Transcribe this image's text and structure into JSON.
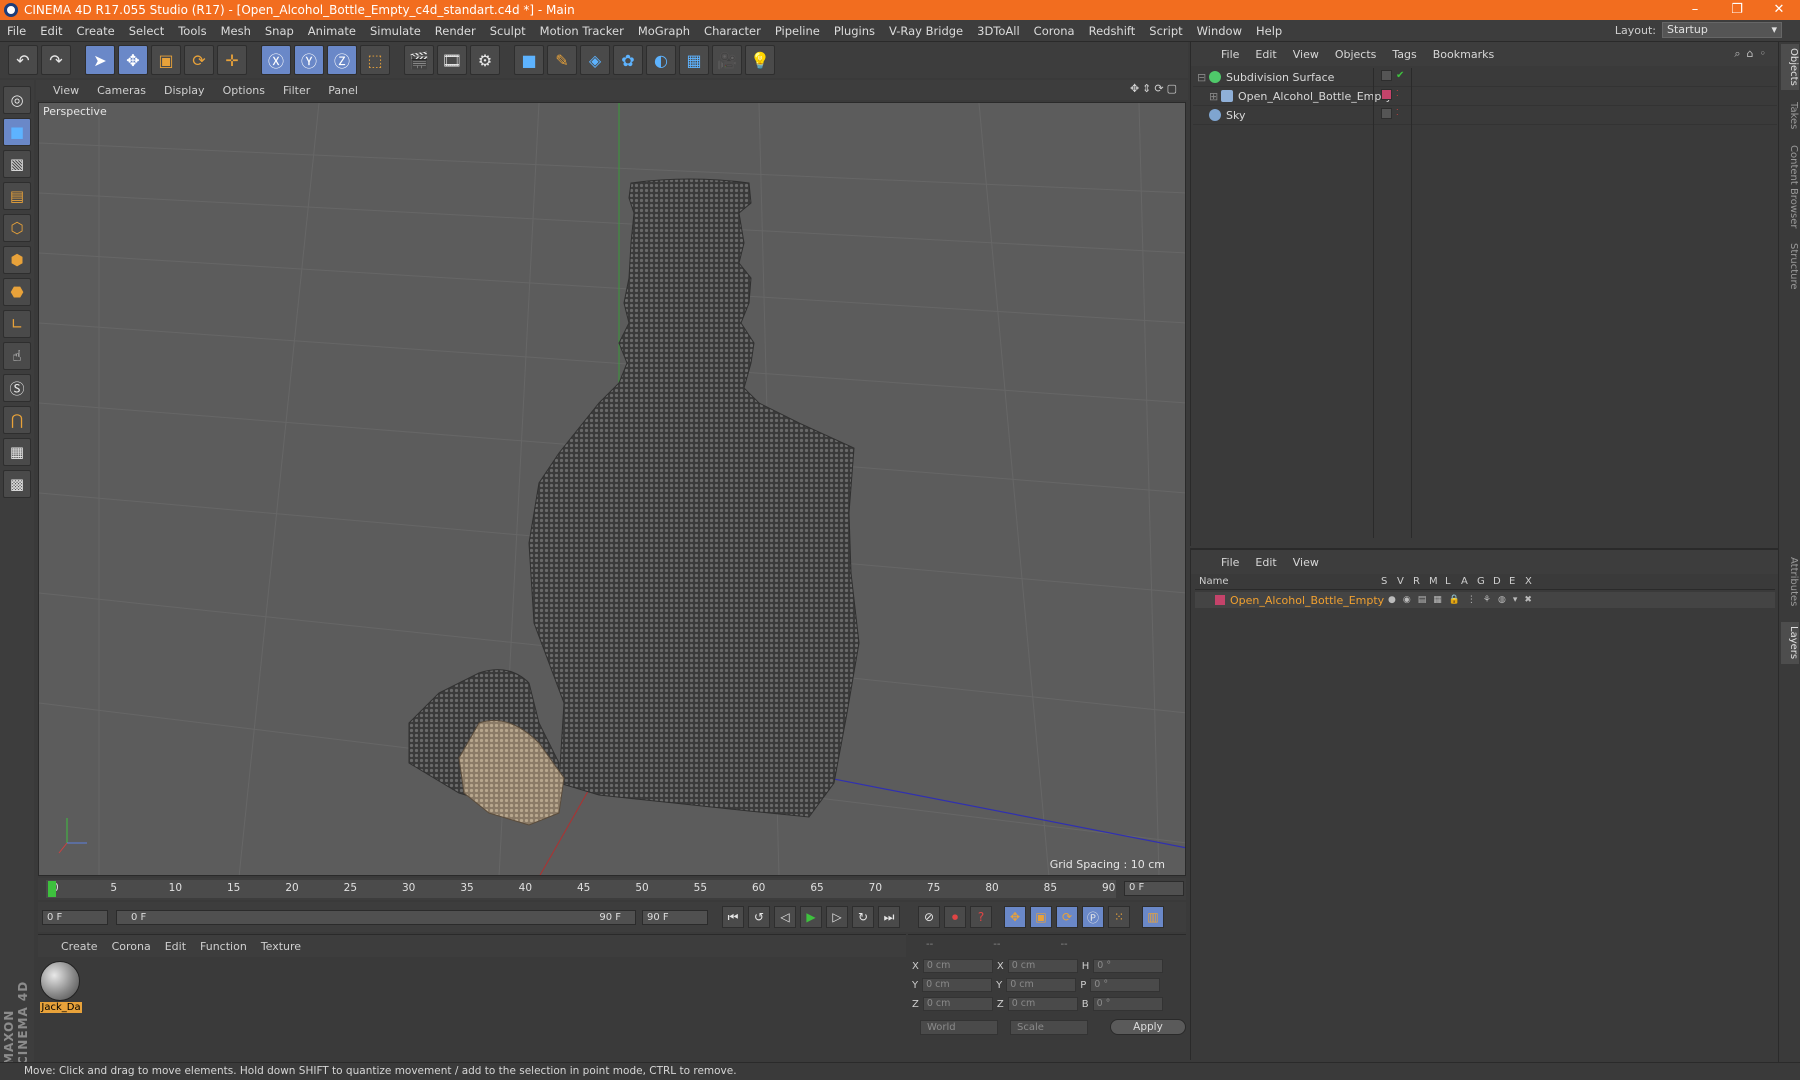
{
  "title": "CINEMA 4D R17.055 Studio (R17) - [Open_Alcohol_Bottle_Empty_c4d_standart.c4d *] - Main",
  "menu": [
    "File",
    "Edit",
    "Create",
    "Select",
    "Tools",
    "Mesh",
    "Snap",
    "Animate",
    "Simulate",
    "Render",
    "Sculpt",
    "Motion Tracker",
    "MoGraph",
    "Character",
    "Pipeline",
    "Plugins",
    "V-Ray Bridge",
    "3DToAll",
    "Corona",
    "Redshift",
    "Script",
    "Window",
    "Help"
  ],
  "layout": {
    "label": "Layout:",
    "value": "Startup"
  },
  "viewport_menu": [
    "View",
    "Cameras",
    "Display",
    "Options",
    "Filter",
    "Panel"
  ],
  "viewport": {
    "camera": "Perspective",
    "grid_spacing": "Grid Spacing : 10 cm"
  },
  "timeline": {
    "ticks": [
      "0",
      "5",
      "10",
      "15",
      "20",
      "25",
      "30",
      "35",
      "40",
      "45",
      "50",
      "55",
      "60",
      "65",
      "70",
      "75",
      "80",
      "85",
      "90"
    ],
    "current_frame": "0 F",
    "start_field": "0 F",
    "range_start": "0 F",
    "range_end": "90 F",
    "end_field": "90 F"
  },
  "material_menu": [
    "Create",
    "Corona",
    "Edit",
    "Function",
    "Texture"
  ],
  "material": {
    "name": "Jack_Da"
  },
  "coords": {
    "headers": [
      "--",
      "--",
      "--"
    ],
    "rows": [
      {
        "a": "X",
        "av": "0 cm",
        "b": "X",
        "bv": "0 cm",
        "c": "H",
        "cv": "0 °"
      },
      {
        "a": "Y",
        "av": "0 cm",
        "b": "Y",
        "bv": "0 cm",
        "c": "P",
        "cv": "0 °"
      },
      {
        "a": "Z",
        "av": "0 cm",
        "b": "Z",
        "bv": "0 cm",
        "c": "B",
        "cv": "0 °"
      }
    ],
    "world": "World",
    "scale": "Scale",
    "apply": "Apply"
  },
  "status": "Move: Click and drag to move elements. Hold down SHIFT to quantize movement / add to the selection in point mode, CTRL to remove.",
  "objects_menu": [
    "File",
    "Edit",
    "View",
    "Objects",
    "Tags",
    "Bookmarks"
  ],
  "objects": [
    {
      "name": "Subdivision Surface",
      "color": "#4fc96a"
    },
    {
      "name": "Open_Alcohol_Bottle_Empty",
      "color": "#8fb0d8"
    },
    {
      "name": "Sky",
      "color": "#7fa5d0"
    }
  ],
  "layers_menu": [
    "File",
    "Edit",
    "View"
  ],
  "layers_header": [
    "Name",
    "S",
    "V",
    "R",
    "M",
    "L",
    "A",
    "G",
    "D",
    "E",
    "X"
  ],
  "layers_row": {
    "name": "Open_Alcohol_Bottle_Empty",
    "color": "#c4436a"
  },
  "side_tabs": [
    "Objects",
    "Takes",
    "Content Browser",
    "Structure",
    "Attributes",
    "Layers"
  ],
  "colors": {
    "accent": "#f26d1f",
    "selection": "#6a88c8",
    "highlight": "#e8a23a"
  }
}
